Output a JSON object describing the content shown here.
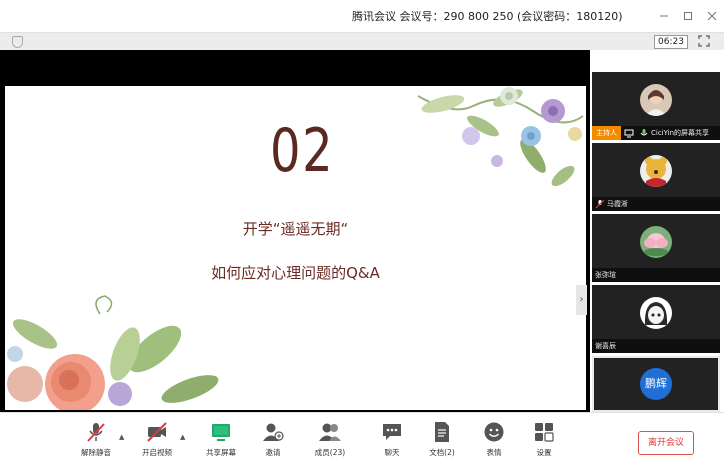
{
  "titlebar": {
    "title": "腾讯会议 会议号：290 800 250  (会议密码：180120)"
  },
  "infobar": {
    "timer": "06:23"
  },
  "slide": {
    "number": "02",
    "line1": "开学“遥遥无期“",
    "line2": "如何应对心理问题的Q&A"
  },
  "participants": [
    {
      "name": "CiciYin的屏幕共享",
      "host_tag": "主持人",
      "avatar": "woman-photo"
    },
    {
      "name": "马霞淅",
      "avatar": "pooh-cartoon"
    },
    {
      "name": "张弥瑄",
      "avatar": "lotus-flower"
    },
    {
      "name": "谢喜辰",
      "avatar": "cartoon-girl"
    },
    {
      "name": "",
      "avatar_text": "鹏辉"
    }
  ],
  "toolbar": {
    "unmute": "解除静音",
    "video": "开启视频",
    "share": "共享屏幕",
    "invite": "邀请",
    "members": "成员(23)",
    "chat": "聊天",
    "docs": "文档(2)",
    "emoji": "表情",
    "settings": "设置",
    "leave": "离开会议"
  },
  "colors": {
    "accent_red": "#e03a3a",
    "host_orange": "#f08a00",
    "slide_text": "#6b2a22"
  }
}
